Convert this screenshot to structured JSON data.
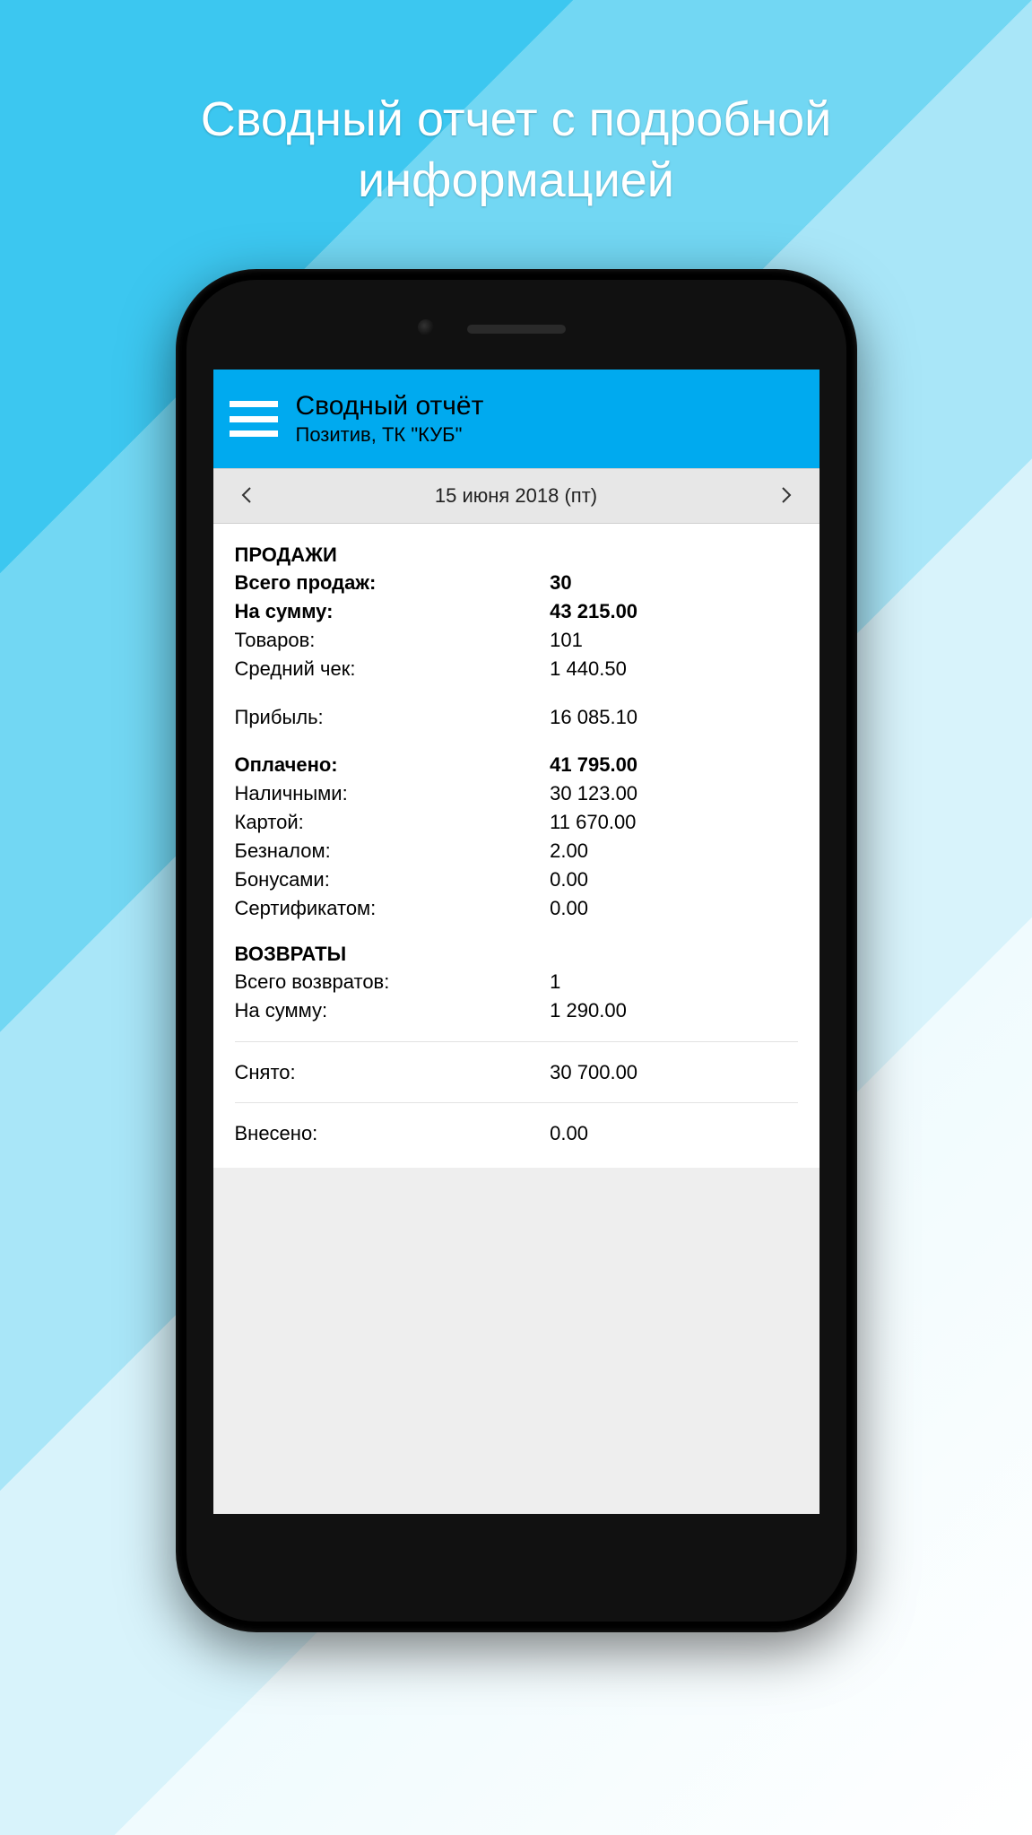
{
  "promo": {
    "line1": "Сводный отчет с подробной",
    "line2": "информацией"
  },
  "header": {
    "title": "Сводный отчёт",
    "subtitle": "Позитив, ТК \"КУБ\""
  },
  "dateBar": {
    "date": "15 июня 2018 (пт)"
  },
  "report": {
    "sales": {
      "heading": "ПРОДАЖИ",
      "totalSales": {
        "label": "Всего продаж:",
        "value": "30"
      },
      "amount": {
        "label": "На сумму:",
        "value": "43 215.00"
      },
      "goods": {
        "label": "Товаров:",
        "value": "101"
      },
      "avgCheck": {
        "label": "Средний чек:",
        "value": "1 440.50"
      },
      "profit": {
        "label": "Прибыль:",
        "value": "16 085.10"
      },
      "paid": {
        "label": "Оплачено:",
        "value": "41 795.00"
      },
      "cash": {
        "label": "Наличными:",
        "value": "30 123.00"
      },
      "card": {
        "label": "Картой:",
        "value": "11 670.00"
      },
      "bank": {
        "label": "Безналом:",
        "value": "2.00"
      },
      "bonus": {
        "label": "Бонусами:",
        "value": "0.00"
      },
      "cert": {
        "label": "Сертификатом:",
        "value": "0.00"
      }
    },
    "returns": {
      "heading": "ВОЗВРАТЫ",
      "totalReturns": {
        "label": "Всего возвратов:",
        "value": "1"
      },
      "amount": {
        "label": "На сумму:",
        "value": "1 290.00"
      }
    },
    "withdrawn": {
      "label": "Снято:",
      "value": "30 700.00"
    },
    "deposited": {
      "label": "Внесено:",
      "value": "0.00"
    }
  }
}
